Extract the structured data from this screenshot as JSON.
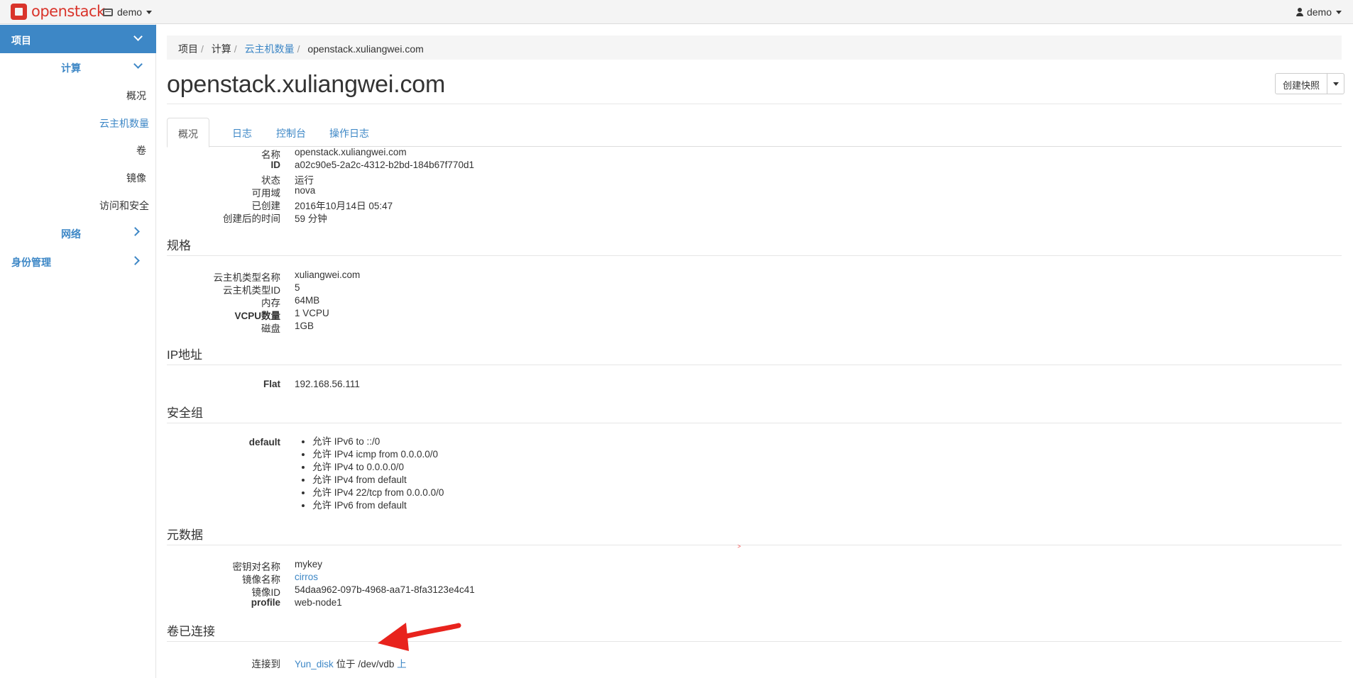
{
  "navbar": {
    "brand": "openstack",
    "project_selector": "demo",
    "user_menu": "demo"
  },
  "sidebar": {
    "project": "项目",
    "compute": "计算",
    "compute_items": [
      "概况",
      "云主机数量",
      "卷",
      "镜像",
      "访问和安全"
    ],
    "network": "网络",
    "identity": "身份管理"
  },
  "breadcrumb": [
    "项目",
    "计算",
    "云主机数量",
    "openstack.xuliangwei.com"
  ],
  "page": {
    "title": "openstack.xuliangwei.com",
    "create_snapshot_button": "创建快照"
  },
  "tabs": [
    "概况",
    "日志",
    "控制台",
    "操作日志"
  ],
  "overview": {
    "fields": [
      {
        "label": "名称",
        "value": "openstack.xuliangwei.com"
      },
      {
        "label": "ID",
        "value": "a02c90e5-2a2c-4312-b2bd-184b67f770d1"
      },
      {
        "label": "状态",
        "value": "运行"
      },
      {
        "label": "可用域",
        "value": "nova"
      },
      {
        "label": "已创建",
        "value": "2016年10月14日 05:47"
      },
      {
        "label": "创建后的时间",
        "value": "59 分钟"
      }
    ]
  },
  "flavor": {
    "title": "规格",
    "fields": [
      {
        "label": "云主机类型名称",
        "value": "xuliangwei.com"
      },
      {
        "label": "云主机类型ID",
        "value": "5"
      },
      {
        "label": "内存",
        "value": "64MB"
      },
      {
        "label": "VCPU数量",
        "value": "1 VCPU"
      },
      {
        "label": "磁盘",
        "value": "1GB"
      }
    ]
  },
  "ip": {
    "title": "IP地址",
    "label": "Flat",
    "value": "192.168.56.111"
  },
  "security_groups": {
    "title": "安全组",
    "label": "default",
    "rules": [
      "允许 IPv6 to ::/0",
      "允许 IPv4 icmp from 0.0.0.0/0",
      "允许 IPv4 to 0.0.0.0/0",
      "允许 IPv4 from default",
      "允许 IPv4 22/tcp from 0.0.0.0/0",
      "允许 IPv6 from default"
    ]
  },
  "metadata": {
    "title": "元数据",
    "fields": [
      {
        "label": "密钥对名称",
        "value": "mykey"
      },
      {
        "label": "镜像名称",
        "value": "cirros"
      },
      {
        "label": "镜像ID",
        "value": "54daa962-097b-4968-aa71-8fa3123e4c41"
      },
      {
        "label": "profile",
        "value": "web-node1"
      }
    ]
  },
  "volumes": {
    "title": "卷已连接",
    "label": "连接到",
    "volume_name": "Yun_disk",
    "text_middle": "位于 /dev/vdb",
    "text_end": "上"
  },
  "colors": {
    "accent": "#3d87c6",
    "brand": "#d9342b",
    "annotation_arrow": "#e8231d"
  }
}
